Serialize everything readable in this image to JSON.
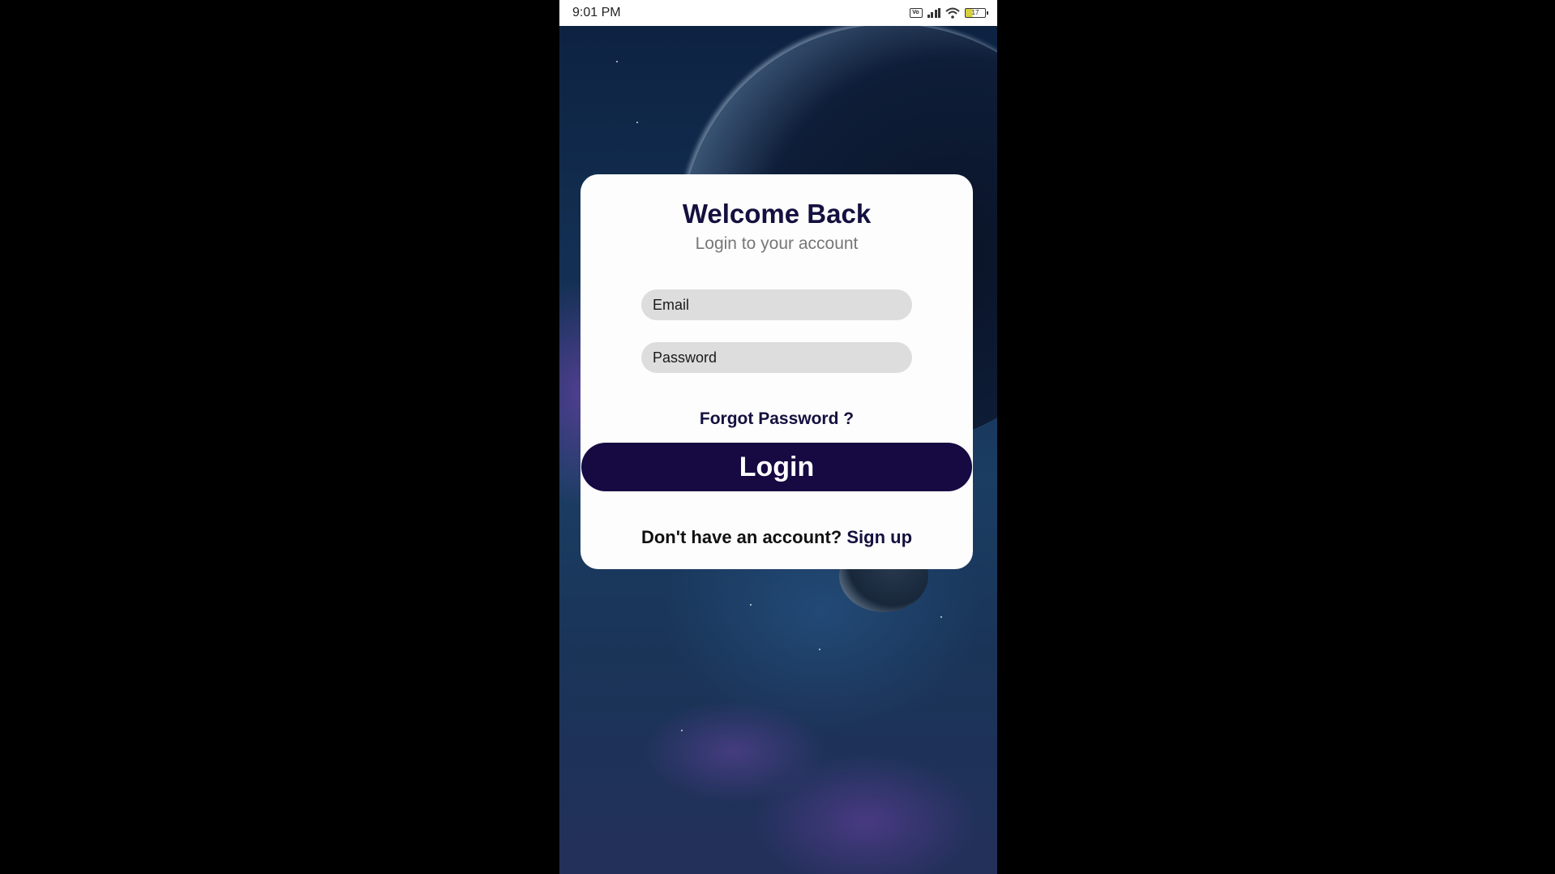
{
  "status_bar": {
    "time": "9:01 PM",
    "volte_label": "Vo",
    "battery_level": "17",
    "icons": [
      "volte-icon",
      "signal-icon",
      "wifi-icon",
      "battery-icon"
    ]
  },
  "login_card": {
    "title": "Welcome Back",
    "subtitle": "Login to your account",
    "email_placeholder": "Email",
    "password_placeholder": "Password",
    "forgot_password": "Forgot Password ?",
    "login_button": "Login",
    "signup_prompt": "Don't have an account?",
    "signup_link": "Sign up"
  },
  "colors": {
    "primary": "#170a42",
    "title": "#14103f",
    "field_bg": "#dcdddc",
    "card_bg": "#fcfdfc"
  }
}
